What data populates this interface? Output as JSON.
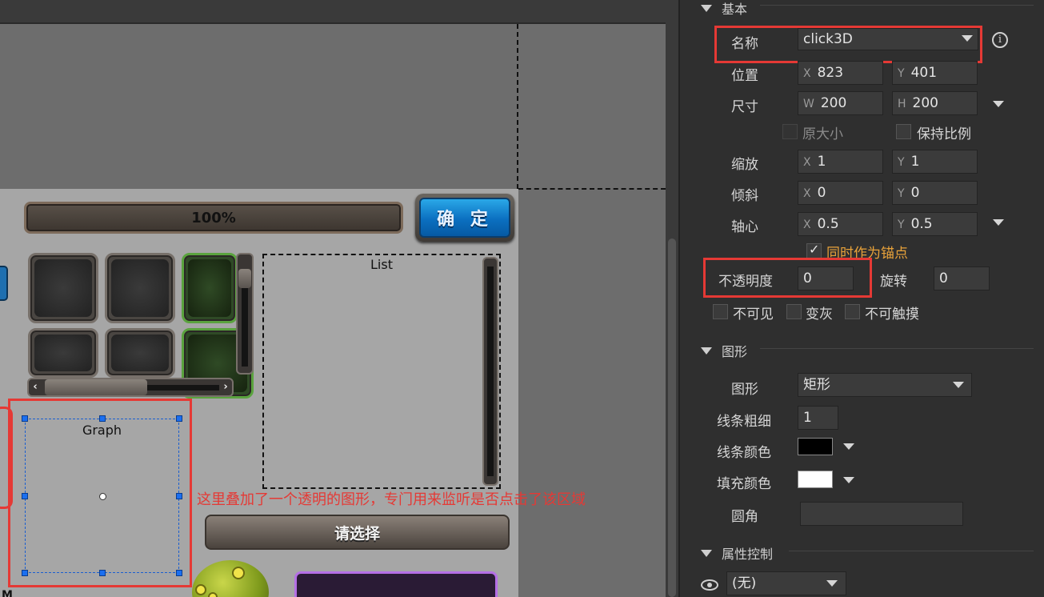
{
  "stage": {
    "progress_text": "100%",
    "ok_button": "确 定",
    "list_label": "List",
    "graph_label": "Graph",
    "annotation": "这里叠加了一个透明的图形，专门用来监听是否点击了该区域",
    "choose_button": "请选择",
    "corner_glyph": "M"
  },
  "panel": {
    "section_basic": "基本",
    "name_label": "名称",
    "name_value": "click3D",
    "position_label": "位置",
    "x_prefix": "X",
    "y_prefix": "Y",
    "w_prefix": "W",
    "h_prefix": "H",
    "pos_x": "823",
    "pos_y": "401",
    "size_label": "尺寸",
    "size_w": "200",
    "size_h": "200",
    "original_size": "原大小",
    "keep_ratio": "保持比例",
    "scale_label": "缩放",
    "scale_x": "1",
    "scale_y": "1",
    "skew_label": "倾斜",
    "skew_x": "0",
    "skew_y": "0",
    "pivot_label": "轴心",
    "pivot_x": "0.5",
    "pivot_y": "0.5",
    "as_anchor": "同时作为锚点",
    "opacity_label": "不透明度",
    "opacity_value": "0",
    "rotation_label": "旋转",
    "rotation_value": "0",
    "invisible": "不可见",
    "grayed": "变灰",
    "untouchable": "不可触摸",
    "section_shape": "图形",
    "shape_label": "图形",
    "shape_value": "矩形",
    "line_width_label": "线条粗细",
    "line_width_value": "1",
    "line_color_label": "线条颜色",
    "line_color": "#000000",
    "fill_color_label": "填充颜色",
    "fill_color": "#ffffff",
    "corner_label": "圆角",
    "corner_value": "",
    "section_props": "属性控制",
    "props_value": "(无)",
    "anchor_color": "#e8a23a"
  }
}
